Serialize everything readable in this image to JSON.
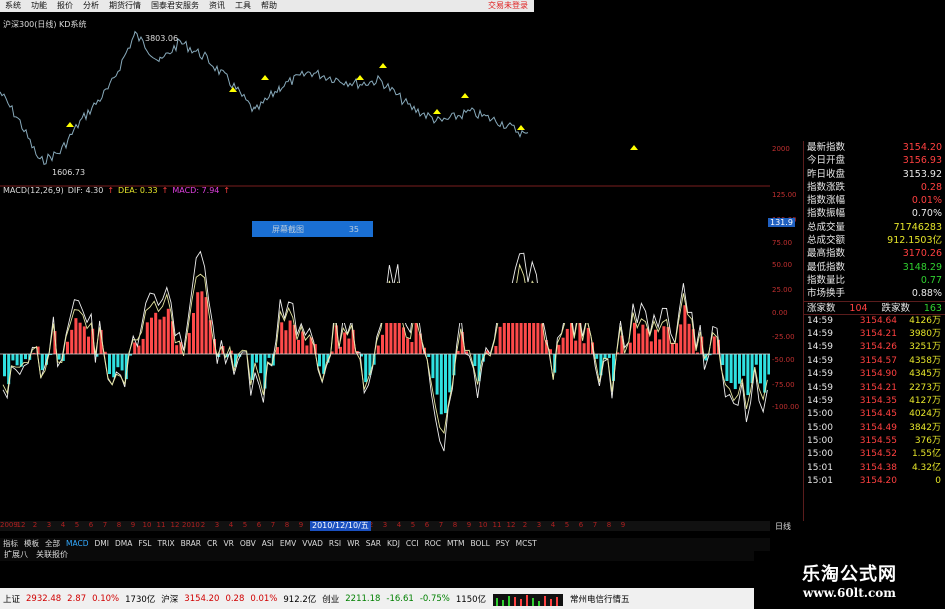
{
  "menu": [
    "系统",
    "功能",
    "报价",
    "分析",
    "期货行情",
    "国泰君安服务",
    "资讯",
    "工具",
    "帮助"
  ],
  "trade_status": "交易未登录",
  "chart": {
    "top_title": "沪深300(日线) KD系统",
    "high_label": "3803.06",
    "low_label": "1606.73",
    "macd": {
      "name": "MACD(12,26,9)",
      "dif": "DIF: 4.30",
      "dif_arrow": "↑",
      "dea": "DEA: 0.33",
      "dea_arrow": "↑",
      "macd": "MACD: 7.94",
      "macd_arrow": "↑"
    },
    "overlay_label": "屏幕截图",
    "overlay_value": "35",
    "current_value": "131.9",
    "axis_ticks": [
      "2000",
      "125.00",
      "100.00",
      "75.00",
      "50.00",
      "25.00",
      "0.00",
      "-25.00",
      "-50.00",
      "-75.00",
      "-100.00"
    ],
    "selected_date": "2010/12/10/五",
    "period": "日线",
    "date_ticks": [
      "2009",
      "12",
      "2",
      "3",
      "4",
      "5",
      "6",
      "7",
      "8",
      "9",
      "10",
      "11",
      "12",
      "2010",
      "2",
      "3",
      "4",
      "5",
      "6",
      "7",
      "8",
      "9",
      "10",
      "11",
      "12",
      "2011",
      "2",
      "3",
      "4",
      "5",
      "6",
      "7",
      "8",
      "9",
      "10",
      "11",
      "12",
      "2",
      "3",
      "4",
      "5",
      "6",
      "7",
      "8",
      "9"
    ]
  },
  "quote": {
    "rows": [
      {
        "k": "最新指数",
        "v": "3154.20",
        "color": "#ff4040"
      },
      {
        "k": "今日开盘",
        "v": "3156.93",
        "color": "#ff4040"
      },
      {
        "k": "昨日收盘",
        "v": "3153.92",
        "color": "#e8e8e8"
      },
      {
        "k": "指数涨跌",
        "v": "0.28",
        "color": "#ff4040"
      },
      {
        "k": "指数涨幅",
        "v": "0.01%",
        "color": "#ff4040"
      },
      {
        "k": "指数振幅",
        "v": "0.70%",
        "color": "#e8e8e8"
      },
      {
        "k": "总成交量",
        "v": "71746283",
        "color": "#e5e52a"
      },
      {
        "k": "总成交额",
        "v": "912.1503亿",
        "color": "#e5e52a"
      },
      {
        "k": "最高指数",
        "v": "3170.26",
        "color": "#ff4040"
      },
      {
        "k": "最低指数",
        "v": "3148.29",
        "color": "#30d030"
      },
      {
        "k": "指数量比",
        "v": "0.77",
        "color": "#30d030"
      },
      {
        "k": "市场换手",
        "v": "0.88%",
        "color": "#e8e8e8"
      }
    ],
    "up_label": "涨家数",
    "up_count": "104",
    "down_label": "跌家数",
    "down_count": "163",
    "ticks": [
      {
        "t": "14:59",
        "p": "3154.64",
        "v": "4126万"
      },
      {
        "t": "14:59",
        "p": "3154.21",
        "v": "3980万"
      },
      {
        "t": "14:59",
        "p": "3154.26",
        "v": "3251万"
      },
      {
        "t": "14:59",
        "p": "3154.57",
        "v": "4358万"
      },
      {
        "t": "14:59",
        "p": "3154.90",
        "v": "4345万"
      },
      {
        "t": "14:59",
        "p": "3154.21",
        "v": "2273万"
      },
      {
        "t": "14:59",
        "p": "3154.35",
        "v": "4127万"
      },
      {
        "t": "15:00",
        "p": "3154.45",
        "v": "4024万"
      },
      {
        "t": "15:00",
        "p": "3154.49",
        "v": "3842万"
      },
      {
        "t": "15:00",
        "p": "3154.55",
        "v": "376万"
      },
      {
        "t": "15:00",
        "p": "3154.52",
        "v": "1.55亿"
      },
      {
        "t": "15:01",
        "p": "3154.38",
        "v": "4.32亿"
      },
      {
        "t": "15:01",
        "p": "3154.20",
        "v": "0"
      }
    ]
  },
  "indicator_tabs": [
    "指标",
    "模板",
    "全部",
    "MACD",
    "DMI",
    "DMA",
    "FSL",
    "TRIX",
    "BRAR",
    "CR",
    "VR",
    "OBV",
    "ASI",
    "EMV",
    "VVAD",
    "RSI",
    "WR",
    "SAR",
    "KDJ",
    "CCI",
    "ROC",
    "MTM",
    "BOLL",
    "PSY",
    "MCST"
  ],
  "sub_tabs": [
    "扩展八",
    "关联报价"
  ],
  "status": {
    "sh_label": "上证",
    "sh_value": "2932.48",
    "sh_chg": "2.87",
    "sh_pct": "0.10%",
    "sh_amt": "1730亿",
    "hs_label": "沪深",
    "hs_value": "3154.20",
    "hs_chg": "0.28",
    "hs_pct": "0.01%",
    "hs_amt": "912.2亿",
    "cy_label": "创业",
    "cy_value": "2211.18",
    "cy_chg": "-16.61",
    "cy_pct": "-0.75%",
    "cy_amt": "1150亿",
    "link": "常州电信行情五"
  },
  "logo": {
    "line1": "乐淘公式网",
    "line2": "www.60lt.com"
  }
}
